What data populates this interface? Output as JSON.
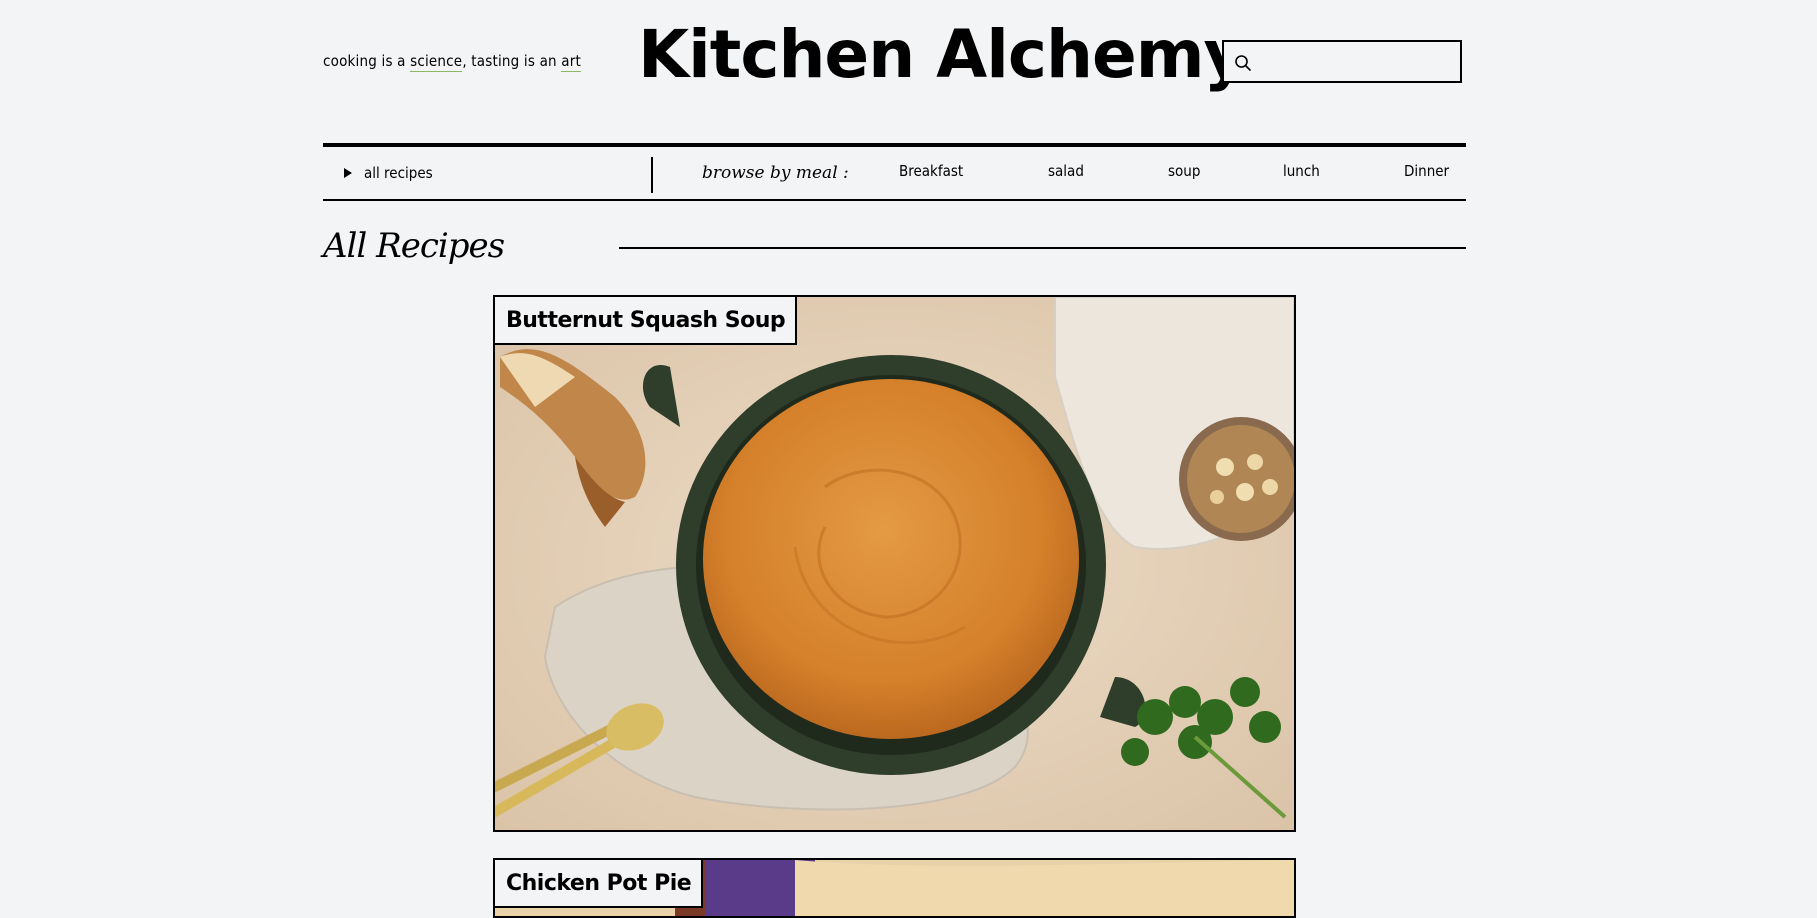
{
  "header": {
    "tagline_part1": "cooking is a ",
    "tagline_science": "science",
    "tagline_part2": ", tasting is an ",
    "tagline_art": "art",
    "site_title": "Kitchen Alchemy",
    "search_placeholder": ""
  },
  "nav": {
    "all_recipes": "all recipes",
    "browse_label": "browse by meal :",
    "meals": [
      "Breakfast",
      "salad",
      "soup",
      "lunch",
      "Dinner"
    ]
  },
  "section": {
    "title": "All Recipes"
  },
  "recipes": [
    {
      "title": "Butternut Squash Soup"
    },
    {
      "title": "Chicken Pot Pie"
    }
  ],
  "colors": {
    "background": "#f3f4f6",
    "tagline_underline": "#8bb867",
    "soup_orange": "#d9822b",
    "pot_green": "#2f3d2b"
  }
}
